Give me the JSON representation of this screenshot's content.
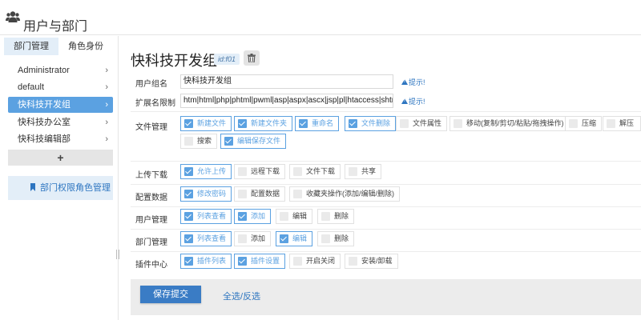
{
  "window": {
    "title": "用户与部门",
    "icon": "users-icon"
  },
  "sidebar": {
    "tabs": [
      {
        "label": "部门管理",
        "active": true
      },
      {
        "label": "角色身份",
        "active": false
      }
    ],
    "items": [
      {
        "label": "Administrator",
        "active": false
      },
      {
        "label": "default",
        "active": false
      },
      {
        "label": "快科技开发组",
        "active": true
      },
      {
        "label": "快科技办公室",
        "active": false
      },
      {
        "label": "快科技编辑部",
        "active": false
      }
    ],
    "chevron": "›",
    "add_label": "+",
    "permission_label": "部门权限角色管理",
    "permission_icon": "bookmark-icon"
  },
  "main": {
    "group_title": "快科技开发组",
    "id_badge": "id:f01",
    "delete_icon": "trash-icon",
    "fields": {
      "group_name": {
        "label": "用户组名",
        "value": "快科技开发组",
        "hint": "提示!"
      },
      "ext_limit": {
        "label": "扩展名限制",
        "value": "htm|html|php|phtml|pwml|asp|aspx|ascx|jsp|pl|htaccess|shtml|shtm|phtm",
        "hint": "提示!"
      }
    },
    "permissions": {
      "file_mgmt": {
        "label": "文件管理",
        "options": [
          {
            "label": "新建文件",
            "checked": true
          },
          {
            "label": "新建文件夹",
            "checked": true
          },
          {
            "label": "重命名",
            "checked": true
          },
          {
            "label": "文件删除",
            "checked": true
          },
          {
            "label": "文件属性",
            "checked": false
          },
          {
            "label": "移动(复制/剪切/粘贴/拖拽操作)",
            "checked": false
          },
          {
            "label": "压缩",
            "checked": false
          },
          {
            "label": "解压",
            "checked": false
          },
          {
            "label": "搜索",
            "checked": false
          },
          {
            "label": "编辑保存文件",
            "checked": true
          }
        ]
      },
      "upload_download": {
        "label": "上传下载",
        "options": [
          {
            "label": "允许上传",
            "checked": true
          },
          {
            "label": "远程下载",
            "checked": false
          },
          {
            "label": "文件下载",
            "checked": false
          },
          {
            "label": "共享",
            "checked": false
          }
        ]
      },
      "config_data": {
        "label": "配置数据",
        "options": [
          {
            "label": "修改密码",
            "checked": true
          },
          {
            "label": "配置数据",
            "checked": false
          },
          {
            "label": "收藏夹操作(添加/编辑/删除)",
            "checked": false
          }
        ]
      },
      "user_mgmt": {
        "label": "用户管理",
        "options": [
          {
            "label": "列表查看",
            "checked": true
          },
          {
            "label": "添加",
            "checked": true
          },
          {
            "label": "编辑",
            "checked": false
          },
          {
            "label": "删除",
            "checked": false
          }
        ]
      },
      "dept_mgmt": {
        "label": "部门管理",
        "options": [
          {
            "label": "列表查看",
            "checked": true
          },
          {
            "label": "添加",
            "checked": false
          },
          {
            "label": "编辑",
            "checked": true
          },
          {
            "label": "删除",
            "checked": false
          }
        ]
      },
      "plugin_center": {
        "label": "插件中心",
        "options": [
          {
            "label": "插件列表",
            "checked": true
          },
          {
            "label": "插件设置",
            "checked": true
          },
          {
            "label": "开启关闭",
            "checked": false
          },
          {
            "label": "安装/卸载",
            "checked": false
          }
        ]
      }
    },
    "footer": {
      "save_label": "保存提交",
      "select_all_label": "全选/反选"
    }
  },
  "colors": {
    "accent": "#5ba1e1",
    "primary_button": "#3a7cc5",
    "link": "#2d75c0",
    "tab_active_bg": "#e3eef8"
  }
}
